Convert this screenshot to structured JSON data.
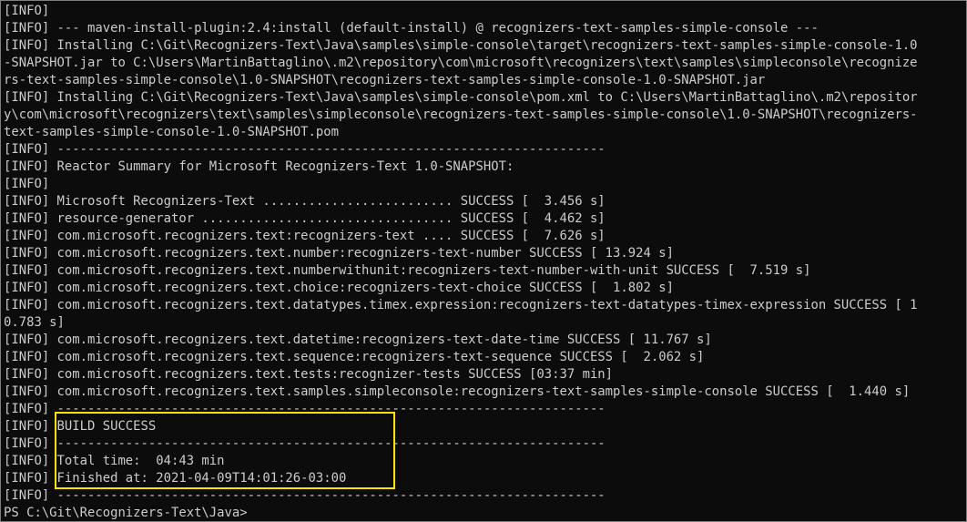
{
  "terminal": {
    "lines": [
      "[INFO]",
      "[INFO] --- maven-install-plugin:2.4:install (default-install) @ recognizers-text-samples-simple-console ---",
      "[INFO] Installing C:\\Git\\Recognizers-Text\\Java\\samples\\simple-console\\target\\recognizers-text-samples-simple-console-1.0",
      "-SNAPSHOT.jar to C:\\Users\\MartinBattaglino\\.m2\\repository\\com\\microsoft\\recognizers\\text\\samples\\simpleconsole\\recognize",
      "rs-text-samples-simple-console\\1.0-SNAPSHOT\\recognizers-text-samples-simple-console-1.0-SNAPSHOT.jar",
      "[INFO] Installing C:\\Git\\Recognizers-Text\\Java\\samples\\simple-console\\pom.xml to C:\\Users\\MartinBattaglino\\.m2\\repositor",
      "y\\com\\microsoft\\recognizers\\text\\samples\\simpleconsole\\recognizers-text-samples-simple-console\\1.0-SNAPSHOT\\recognizers-",
      "text-samples-simple-console-1.0-SNAPSHOT.pom",
      "[INFO] ------------------------------------------------------------------------",
      "[INFO] Reactor Summary for Microsoft Recognizers-Text 1.0-SNAPSHOT:",
      "[INFO]",
      "[INFO] Microsoft Recognizers-Text ......................... SUCCESS [  3.456 s]",
      "[INFO] resource-generator ................................. SUCCESS [  4.462 s]",
      "[INFO] com.microsoft.recognizers.text:recognizers-text .... SUCCESS [  7.626 s]",
      "[INFO] com.microsoft.recognizers.text.number:recognizers-text-number SUCCESS [ 13.924 s]",
      "[INFO] com.microsoft.recognizers.text.numberwithunit:recognizers-text-number-with-unit SUCCESS [  7.519 s]",
      "[INFO] com.microsoft.recognizers.text.choice:recognizers-text-choice SUCCESS [  1.802 s]",
      "[INFO] com.microsoft.recognizers.text.datatypes.timex.expression:recognizers-text-datatypes-timex-expression SUCCESS [ 1",
      "0.783 s]",
      "[INFO] com.microsoft.recognizers.text.datetime:recognizers-text-date-time SUCCESS [ 11.767 s]",
      "[INFO] com.microsoft.recognizers.text.sequence:recognizers-text-sequence SUCCESS [  2.062 s]",
      "[INFO] com.microsoft.recognizers.text.tests:recognizer-tests SUCCESS [03:37 min]",
      "[INFO] com.microsoft.recognizers.text.samples.simpleconsole:recognizers-text-samples-simple-console SUCCESS [  1.440 s]",
      "[INFO] ------------------------------------------------------------------------",
      "[INFO] BUILD SUCCESS",
      "[INFO] ------------------------------------------------------------------------",
      "[INFO] Total time:  04:43 min",
      "[INFO] Finished at: 2021-04-09T14:01:26-03:00",
      "[INFO] ------------------------------------------------------------------------",
      "PS C:\\Git\\Recognizers-Text\\Java>"
    ]
  },
  "colors": {
    "background": "#0c0c0c",
    "text": "#cccccc",
    "highlight_border": "#ffe400"
  }
}
